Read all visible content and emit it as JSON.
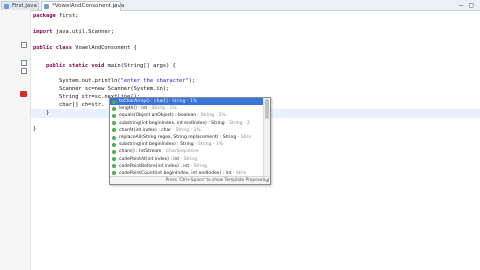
{
  "tabs": [
    {
      "label": "First.java",
      "active": false
    },
    {
      "label": "*VowelAndConsonent.java",
      "active": true
    }
  ],
  "window_controls": {
    "minimize": "–",
    "maximize": "□"
  },
  "code": [
    {
      "kw": "package",
      "rest": " first;"
    },
    {
      "kw": "",
      "rest": ""
    },
    {
      "kw": "import",
      "rest": " java.util.Scanner;"
    },
    {
      "kw": "",
      "rest": ""
    },
    {
      "kw": "public class",
      "rest": " VowelAndConsonent {"
    },
    {
      "kw": "",
      "rest": ""
    },
    {
      "kw": "    public static void",
      "rest": " main(String[] args) {"
    },
    {
      "kw": "",
      "rest": ""
    },
    {
      "pre": "        System.out.println(",
      "str": "\"enter the character\"",
      "post": ");"
    },
    {
      "kw": "",
      "rest": "        Scanner sc=new Scanner(System.in);"
    },
    {
      "kw": "",
      "rest": "        String str=sc.nextLine();"
    },
    {
      "kw": "",
      "rest": "        char[] ch=str."
    },
    {
      "kw": "",
      "rest": "    }"
    },
    {
      "kw": "",
      "rest": "}"
    }
  ],
  "autocomplete": {
    "items": [
      {
        "sig": "toCharArray() : char[]",
        "src": " - String - 1%"
      },
      {
        "sig": "length() : int",
        "src": " - String - 1%"
      },
      {
        "sig": "equals(Object anObject) : boolean",
        "src": " - String - 2%"
      },
      {
        "sig": "substring(int beginIndex, int endIndex) : String",
        "src": " - String - 2"
      },
      {
        "sig": "charAt(int index) : char",
        "src": " - String - 1%"
      },
      {
        "sig": "replaceAll(String regex, String replacement) : String",
        "src": " - Strin"
      },
      {
        "sig": "substring(int beginIndex) : String",
        "src": " - String - 1%"
      },
      {
        "sig": "chars() : IntStream",
        "src": " - CharSequence"
      },
      {
        "sig": "codePointAt(int index) : int",
        "src": " - String"
      },
      {
        "sig": "codePointBefore(int index) : int",
        "src": " - String"
      },
      {
        "sig": "codePointCount(int beginIndex, int endIndex) : int",
        "src": " - Strin"
      }
    ],
    "status": "Press 'Ctrl+Space' to show Template Proposals"
  },
  "colors": {
    "keyword": "#7f0055",
    "string": "#2a00ff",
    "selection": "#3875d7"
  }
}
